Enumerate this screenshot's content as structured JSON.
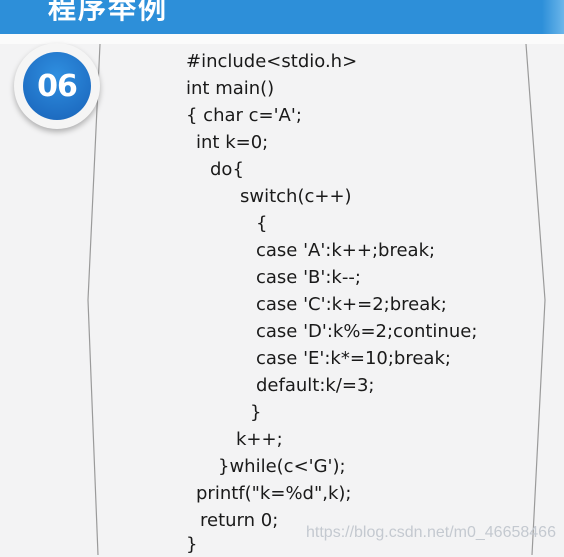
{
  "banner": {
    "title": "程序举例"
  },
  "badge": {
    "number": "06"
  },
  "code": {
    "lines": [
      "#include<stdio.h>",
      "int main()",
      "{ char c='A';",
      "int k=0;",
      "do{",
      "switch(c++)",
      "{",
      "case 'A':k++;break;",
      "case 'B':k--;",
      "case 'C':k+=2;break;",
      "case 'D':k%=2;continue;",
      "case 'E':k*=10;break;",
      "default:k/=3;",
      "}",
      "k++;",
      "}while(c<'G');",
      "printf(\"k=%d\",k);",
      "return 0;",
      "}"
    ]
  },
  "watermark": {
    "text": "https://blog.csdn.net/m0_46658466"
  },
  "colors": {
    "banner": "#2d8fd9",
    "badge": "#1f6fc4"
  }
}
